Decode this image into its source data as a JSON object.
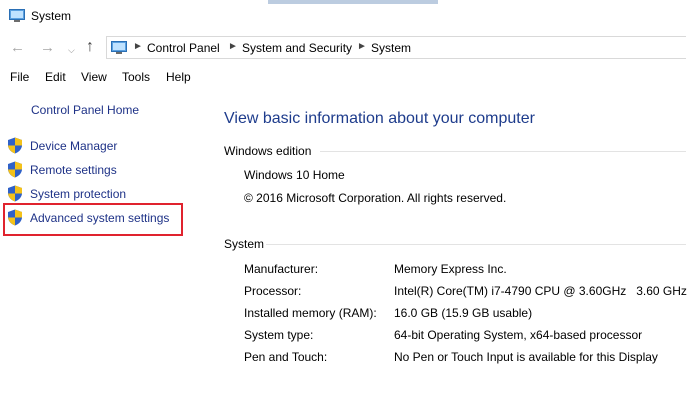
{
  "window": {
    "title": "System",
    "title_icon": "computer-icon"
  },
  "address": {
    "back_icon": "back-arrow-icon",
    "forward_icon": "forward-arrow-icon",
    "recent_icon": "chevron-down-icon",
    "up_icon": "up-arrow-icon",
    "location_icon": "control-panel-icon",
    "crumbs": [
      "Control Panel",
      "System and Security",
      "System"
    ]
  },
  "menu": [
    "File",
    "Edit",
    "View",
    "Tools",
    "Help"
  ],
  "sidebar": {
    "home": "Control Panel Home",
    "links": [
      "Device Manager",
      "Remote settings",
      "System protection",
      "Advanced system settings"
    ],
    "link_icon": "uac-shield-icon"
  },
  "main": {
    "title": "View basic information about your computer",
    "windows_edition": {
      "heading": "Windows edition",
      "edition": "Windows 10 Home",
      "copyright": "© 2016 Microsoft Corporation. All rights reserved."
    },
    "system": {
      "heading": "System",
      "rows": [
        {
          "label": "Manufacturer:",
          "value": "Memory Express Inc."
        },
        {
          "label": "Processor:",
          "value": "Intel(R) Core(TM) i7-4790 CPU @ 3.60GHz   3.60 GHz"
        },
        {
          "label": "Installed memory (RAM):",
          "value": "16.0 GB (15.9 GB usable)"
        },
        {
          "label": "System type:",
          "value": "64-bit Operating System, x64-based processor"
        },
        {
          "label": "Pen and Touch:",
          "value": "No Pen or Touch Input is available for this Display"
        }
      ]
    }
  },
  "colors": {
    "link": "#1e3287",
    "title_blue": "#1e3c8c",
    "highlight": "#e0232e"
  }
}
